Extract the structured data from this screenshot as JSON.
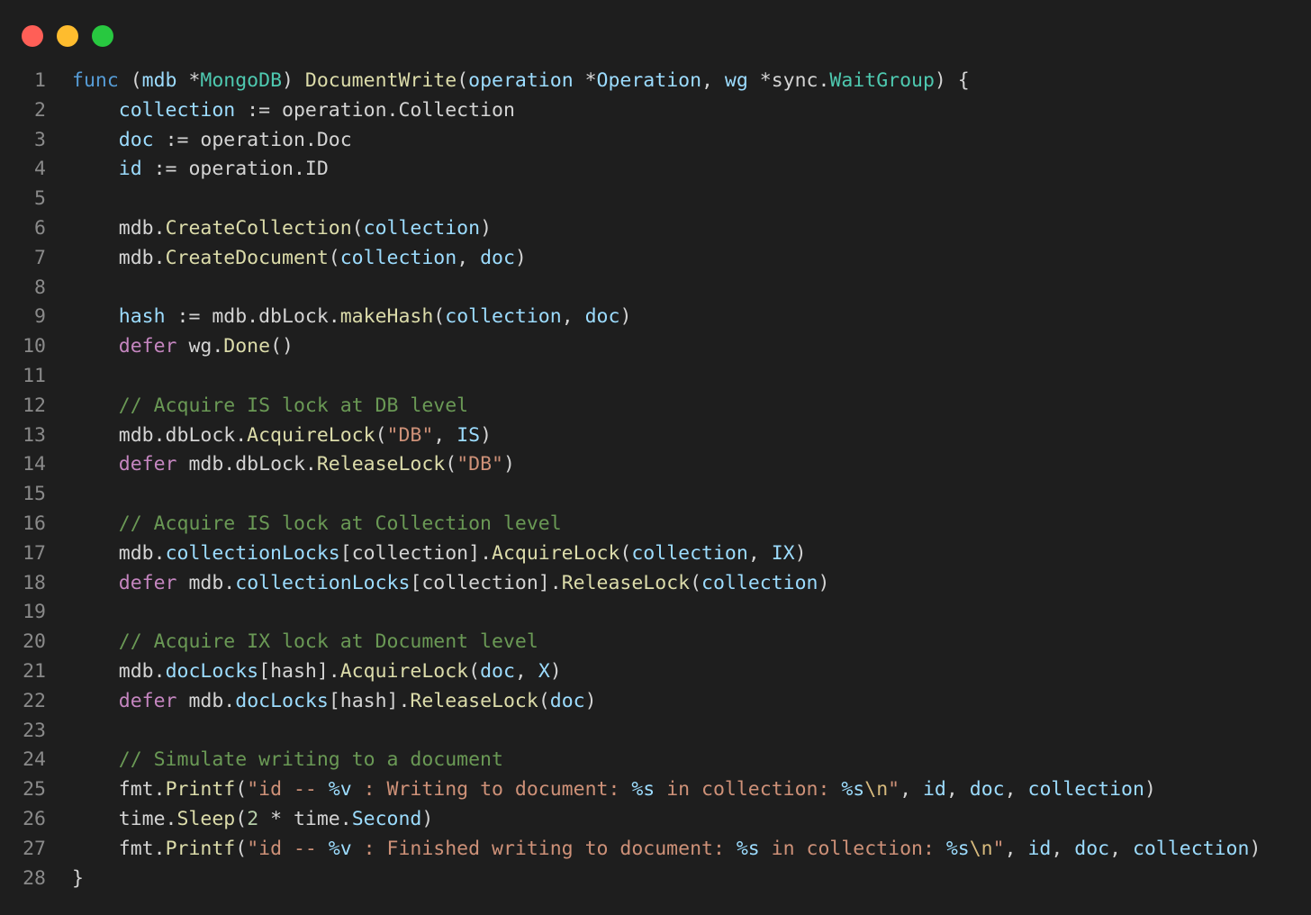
{
  "window": {
    "controls": [
      {
        "name": "close",
        "color": "#ff5f57"
      },
      {
        "name": "minimize",
        "color": "#febc2e"
      },
      {
        "name": "zoom",
        "color": "#28c840"
      }
    ]
  },
  "editor": {
    "language": "go",
    "lines": [
      {
        "num": "1",
        "tokens": [
          [
            "kw",
            "func"
          ],
          [
            "pl",
            " ("
          ],
          [
            "var",
            "mdb"
          ],
          [
            "pl",
            " *"
          ],
          [
            "ty",
            "MongoDB"
          ],
          [
            "pl",
            ") "
          ],
          [
            "fn",
            "DocumentWrite"
          ],
          [
            "pl",
            "("
          ],
          [
            "var",
            "operation"
          ],
          [
            "pl",
            " *"
          ],
          [
            "var",
            "Operation"
          ],
          [
            "pl",
            ", "
          ],
          [
            "var",
            "wg"
          ],
          [
            "pl",
            " *sync."
          ],
          [
            "ty",
            "WaitGroup"
          ],
          [
            "pl",
            ") {"
          ]
        ]
      },
      {
        "num": "2",
        "tokens": [
          [
            "pl",
            "    "
          ],
          [
            "var",
            "collection"
          ],
          [
            "pl",
            " := operation.Collection"
          ]
        ]
      },
      {
        "num": "3",
        "tokens": [
          [
            "pl",
            "    "
          ],
          [
            "var",
            "doc"
          ],
          [
            "pl",
            " := operation.Doc"
          ]
        ]
      },
      {
        "num": "4",
        "tokens": [
          [
            "pl",
            "    "
          ],
          [
            "var",
            "id"
          ],
          [
            "pl",
            " := operation.ID"
          ]
        ]
      },
      {
        "num": "5",
        "tokens": []
      },
      {
        "num": "6",
        "tokens": [
          [
            "pl",
            "    mdb."
          ],
          [
            "fn",
            "CreateCollection"
          ],
          [
            "pl",
            "("
          ],
          [
            "var",
            "collection"
          ],
          [
            "pl",
            ")"
          ]
        ]
      },
      {
        "num": "7",
        "tokens": [
          [
            "pl",
            "    mdb."
          ],
          [
            "fn",
            "CreateDocument"
          ],
          [
            "pl",
            "("
          ],
          [
            "var",
            "collection"
          ],
          [
            "pl",
            ", "
          ],
          [
            "var",
            "doc"
          ],
          [
            "pl",
            ")"
          ]
        ]
      },
      {
        "num": "8",
        "tokens": []
      },
      {
        "num": "9",
        "tokens": [
          [
            "pl",
            "    "
          ],
          [
            "var",
            "hash"
          ],
          [
            "pl",
            " := mdb.dbLock."
          ],
          [
            "fn",
            "makeHash"
          ],
          [
            "pl",
            "("
          ],
          [
            "var",
            "collection"
          ],
          [
            "pl",
            ", "
          ],
          [
            "var",
            "doc"
          ],
          [
            "pl",
            ")"
          ]
        ]
      },
      {
        "num": "10",
        "tokens": [
          [
            "pl",
            "    "
          ],
          [
            "ctl",
            "defer"
          ],
          [
            "pl",
            " wg."
          ],
          [
            "fn",
            "Done"
          ],
          [
            "pl",
            "()"
          ]
        ]
      },
      {
        "num": "11",
        "tokens": []
      },
      {
        "num": "12",
        "tokens": [
          [
            "pl",
            "    "
          ],
          [
            "cm",
            "// Acquire IS lock at DB level"
          ]
        ]
      },
      {
        "num": "13",
        "tokens": [
          [
            "pl",
            "    mdb.dbLock."
          ],
          [
            "fn",
            "AcquireLock"
          ],
          [
            "pl",
            "("
          ],
          [
            "str",
            "\"DB\""
          ],
          [
            "pl",
            ", "
          ],
          [
            "var",
            "IS"
          ],
          [
            "pl",
            ")"
          ]
        ]
      },
      {
        "num": "14",
        "tokens": [
          [
            "pl",
            "    "
          ],
          [
            "ctl",
            "defer"
          ],
          [
            "pl",
            " mdb.dbLock."
          ],
          [
            "fn",
            "ReleaseLock"
          ],
          [
            "pl",
            "("
          ],
          [
            "str",
            "\"DB\""
          ],
          [
            "pl",
            ")"
          ]
        ]
      },
      {
        "num": "15",
        "tokens": []
      },
      {
        "num": "16",
        "tokens": [
          [
            "pl",
            "    "
          ],
          [
            "cm",
            "// Acquire IS lock at Collection level"
          ]
        ]
      },
      {
        "num": "17",
        "tokens": [
          [
            "pl",
            "    mdb."
          ],
          [
            "var",
            "collectionLocks"
          ],
          [
            "pl",
            "[collection]."
          ],
          [
            "fn",
            "AcquireLock"
          ],
          [
            "pl",
            "("
          ],
          [
            "var",
            "collection"
          ],
          [
            "pl",
            ", "
          ],
          [
            "var",
            "IX"
          ],
          [
            "pl",
            ")"
          ]
        ]
      },
      {
        "num": "18",
        "tokens": [
          [
            "pl",
            "    "
          ],
          [
            "ctl",
            "defer"
          ],
          [
            "pl",
            " mdb."
          ],
          [
            "var",
            "collectionLocks"
          ],
          [
            "pl",
            "[collection]."
          ],
          [
            "fn",
            "ReleaseLock"
          ],
          [
            "pl",
            "("
          ],
          [
            "var",
            "collection"
          ],
          [
            "pl",
            ")"
          ]
        ]
      },
      {
        "num": "19",
        "tokens": []
      },
      {
        "num": "20",
        "tokens": [
          [
            "pl",
            "    "
          ],
          [
            "cm",
            "// Acquire IX lock at Document level"
          ]
        ]
      },
      {
        "num": "21",
        "tokens": [
          [
            "pl",
            "    mdb."
          ],
          [
            "var",
            "docLocks"
          ],
          [
            "pl",
            "[hash]."
          ],
          [
            "fn",
            "AcquireLock"
          ],
          [
            "pl",
            "("
          ],
          [
            "var",
            "doc"
          ],
          [
            "pl",
            ", "
          ],
          [
            "var",
            "X"
          ],
          [
            "pl",
            ")"
          ]
        ]
      },
      {
        "num": "22",
        "tokens": [
          [
            "pl",
            "    "
          ],
          [
            "ctl",
            "defer"
          ],
          [
            "pl",
            " mdb."
          ],
          [
            "var",
            "docLocks"
          ],
          [
            "pl",
            "[hash]."
          ],
          [
            "fn",
            "ReleaseLock"
          ],
          [
            "pl",
            "("
          ],
          [
            "var",
            "doc"
          ],
          [
            "pl",
            ")"
          ]
        ]
      },
      {
        "num": "23",
        "tokens": []
      },
      {
        "num": "24",
        "tokens": [
          [
            "pl",
            "    "
          ],
          [
            "cm",
            "// Simulate writing to a document"
          ]
        ]
      },
      {
        "num": "25",
        "tokens": [
          [
            "pl",
            "    fmt."
          ],
          [
            "fn",
            "Printf"
          ],
          [
            "pl",
            "("
          ],
          [
            "str",
            "\"id -- "
          ],
          [
            "var",
            "%v"
          ],
          [
            "str",
            " : Writing to document: "
          ],
          [
            "var",
            "%s"
          ],
          [
            "str",
            " in collection: "
          ],
          [
            "var",
            "%s"
          ],
          [
            "esc",
            "\\n"
          ],
          [
            "str",
            "\""
          ],
          [
            "pl",
            ", "
          ],
          [
            "var",
            "id"
          ],
          [
            "pl",
            ", "
          ],
          [
            "var",
            "doc"
          ],
          [
            "pl",
            ", "
          ],
          [
            "var",
            "collection"
          ],
          [
            "pl",
            ")"
          ]
        ]
      },
      {
        "num": "26",
        "tokens": [
          [
            "pl",
            "    time."
          ],
          [
            "fn",
            "Sleep"
          ],
          [
            "pl",
            "("
          ],
          [
            "num",
            "2"
          ],
          [
            "pl",
            " * time."
          ],
          [
            "var",
            "Second"
          ],
          [
            "pl",
            ")"
          ]
        ]
      },
      {
        "num": "27",
        "tokens": [
          [
            "pl",
            "    fmt."
          ],
          [
            "fn",
            "Printf"
          ],
          [
            "pl",
            "("
          ],
          [
            "str",
            "\"id -- "
          ],
          [
            "var",
            "%v"
          ],
          [
            "str",
            " : Finished writing to document: "
          ],
          [
            "var",
            "%s"
          ],
          [
            "str",
            " in collection: "
          ],
          [
            "var",
            "%s"
          ],
          [
            "esc",
            "\\n"
          ],
          [
            "str",
            "\""
          ],
          [
            "pl",
            ", "
          ],
          [
            "var",
            "id"
          ],
          [
            "pl",
            ", "
          ],
          [
            "var",
            "doc"
          ],
          [
            "pl",
            ", "
          ],
          [
            "var",
            "collection"
          ],
          [
            "pl",
            ")"
          ]
        ]
      },
      {
        "num": "28",
        "tokens": [
          [
            "pl",
            "}"
          ]
        ]
      }
    ]
  }
}
